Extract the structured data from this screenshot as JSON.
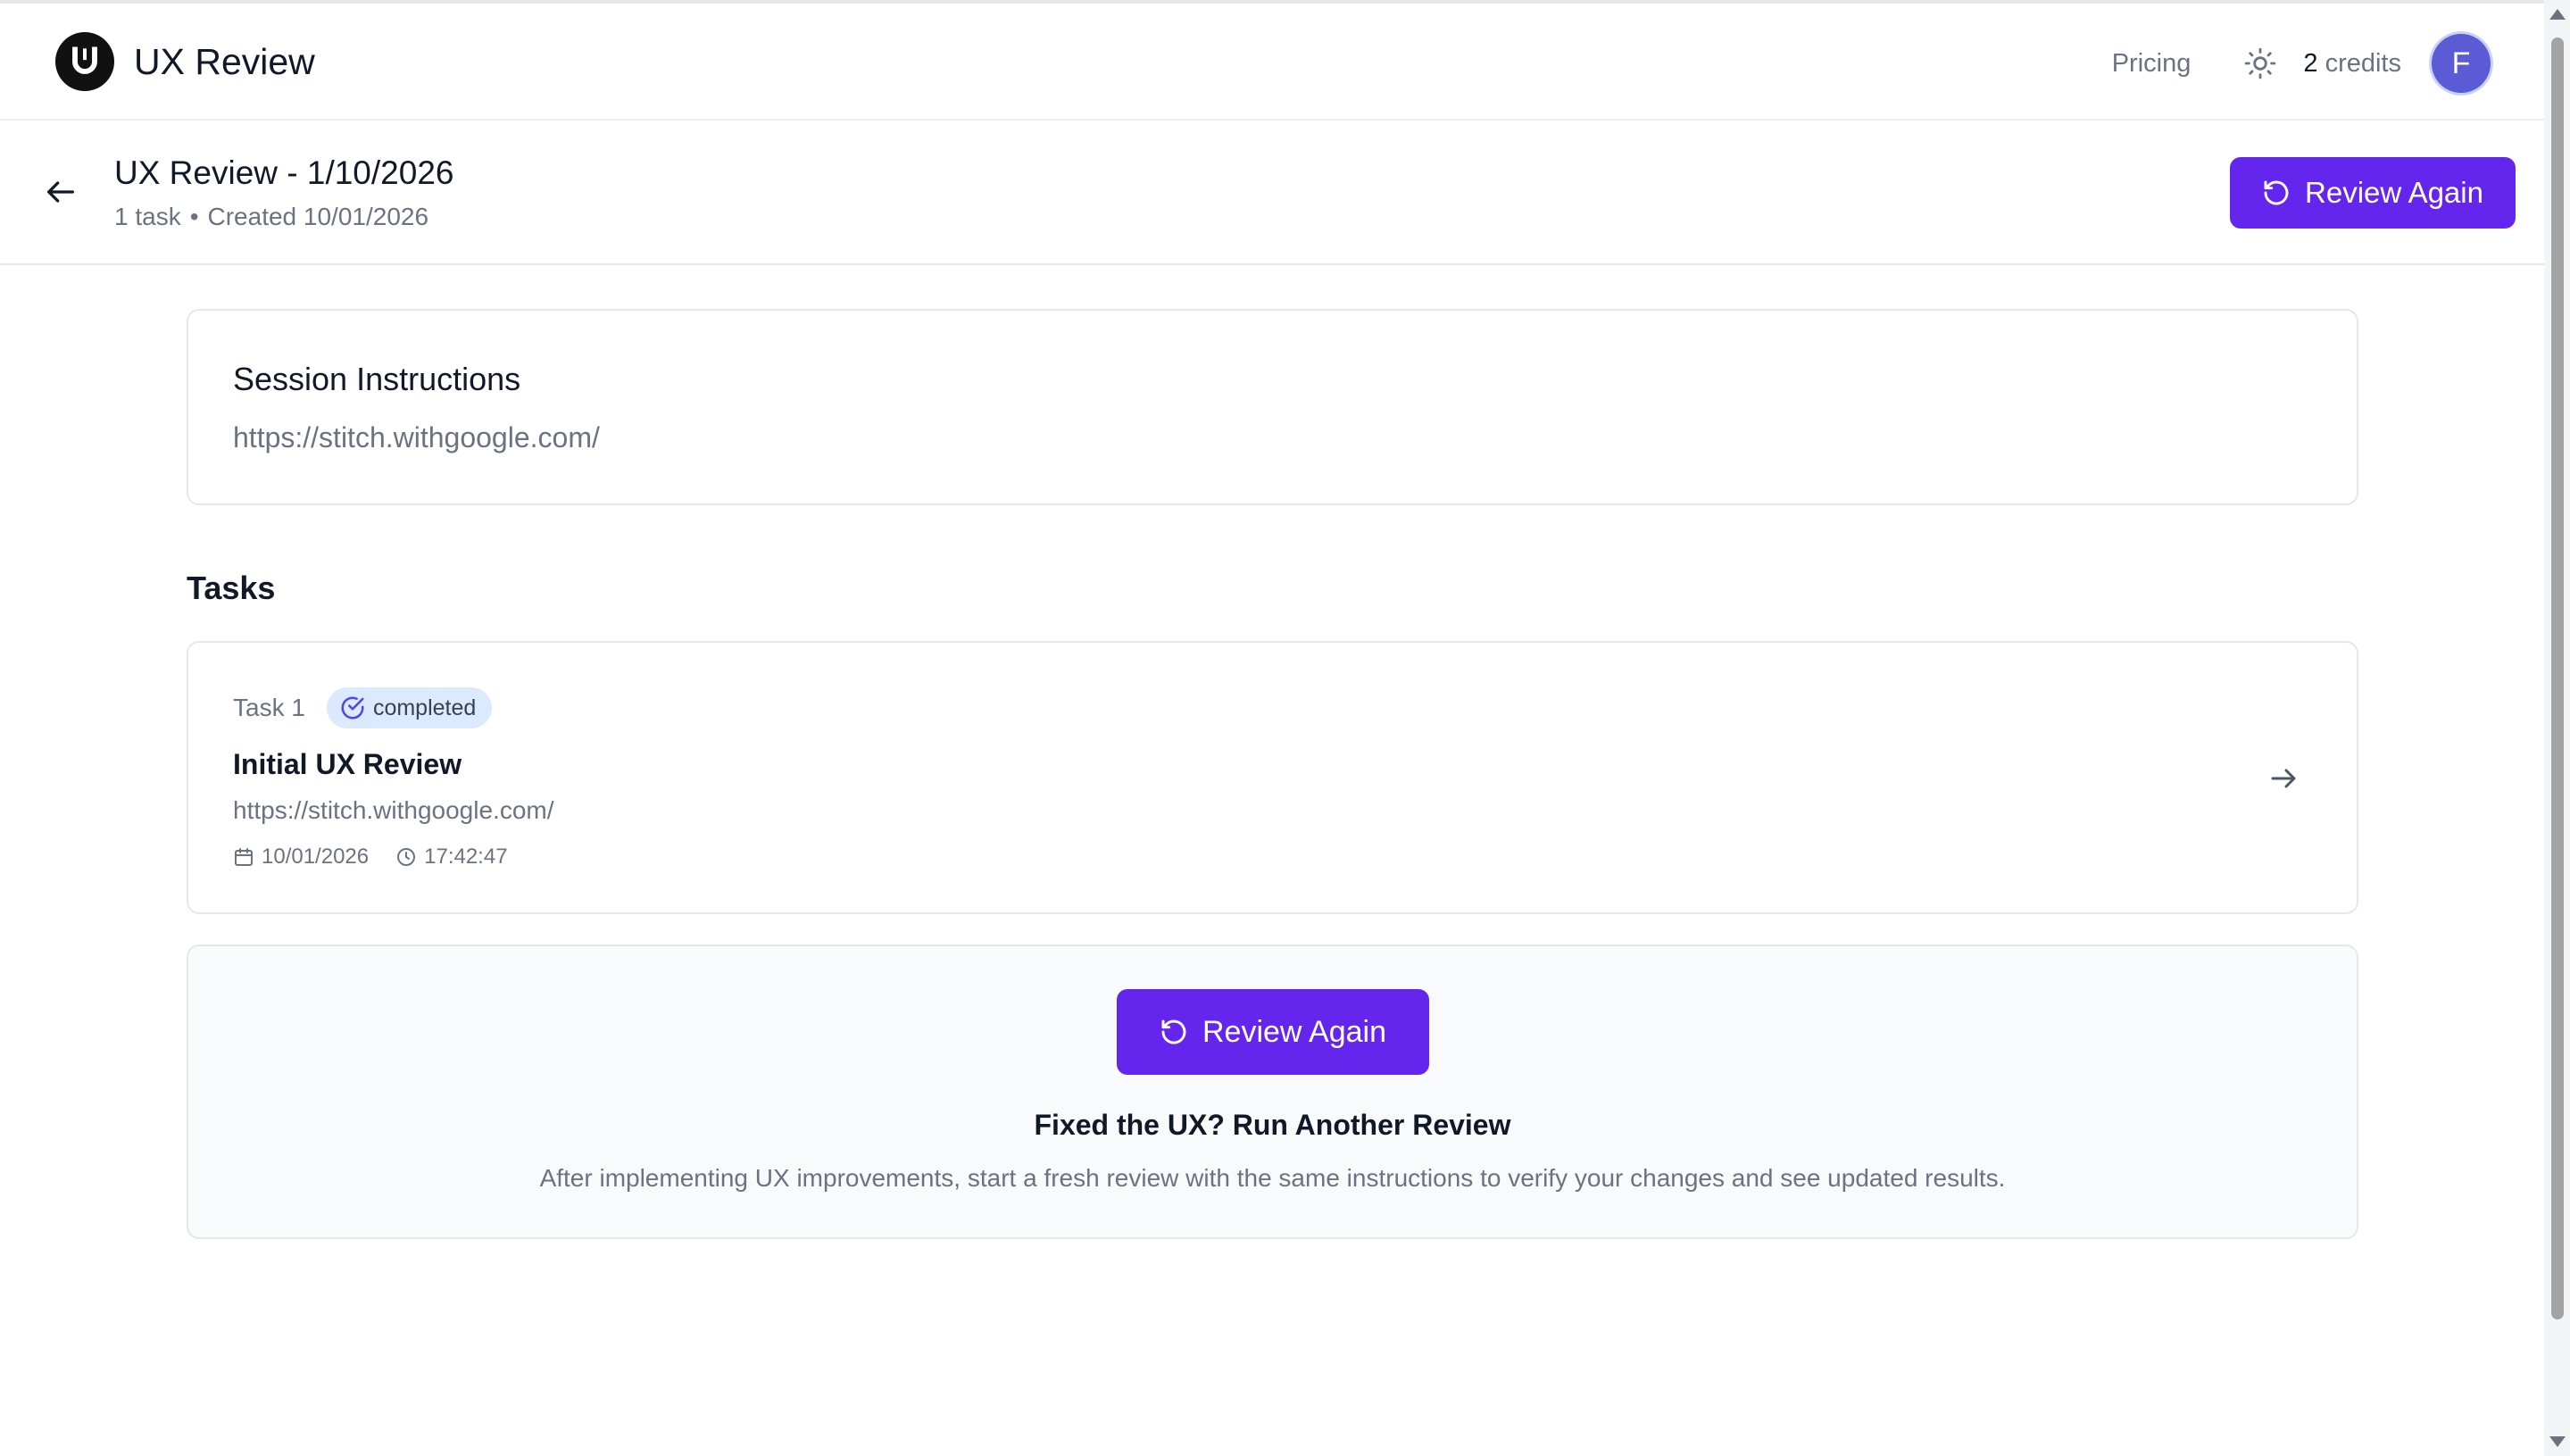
{
  "app": {
    "name": "UX Review",
    "logo_icon": "magnet-icon"
  },
  "nav": {
    "pricing": "Pricing",
    "theme_icon": "sun-icon",
    "credits_count": "2",
    "credits_label": "credits",
    "avatar_initial": "F"
  },
  "session": {
    "title": "UX Review - 1/10/2026",
    "task_count": "1 task",
    "created": "Created 10/01/2026",
    "review_again": "Review Again"
  },
  "instructions": {
    "heading": "Session Instructions",
    "url": "https://stitch.withgoogle.com/"
  },
  "tasks": {
    "heading": "Tasks",
    "items": [
      {
        "label": "Task 1",
        "status": "completed",
        "title": "Initial UX Review",
        "url": "https://stitch.withgoogle.com/",
        "date": "10/01/2026",
        "time": "17:42:47"
      }
    ]
  },
  "cta": {
    "button": "Review Again",
    "heading": "Fixed the UX? Run Another Review",
    "text": "After implementing UX improvements, start a fresh review with the same instructions to verify your changes and see updated results."
  },
  "colors": {
    "primary": "#6426ec",
    "badge_bg": "#dbeafe",
    "avatar": "#5b5bd6"
  }
}
